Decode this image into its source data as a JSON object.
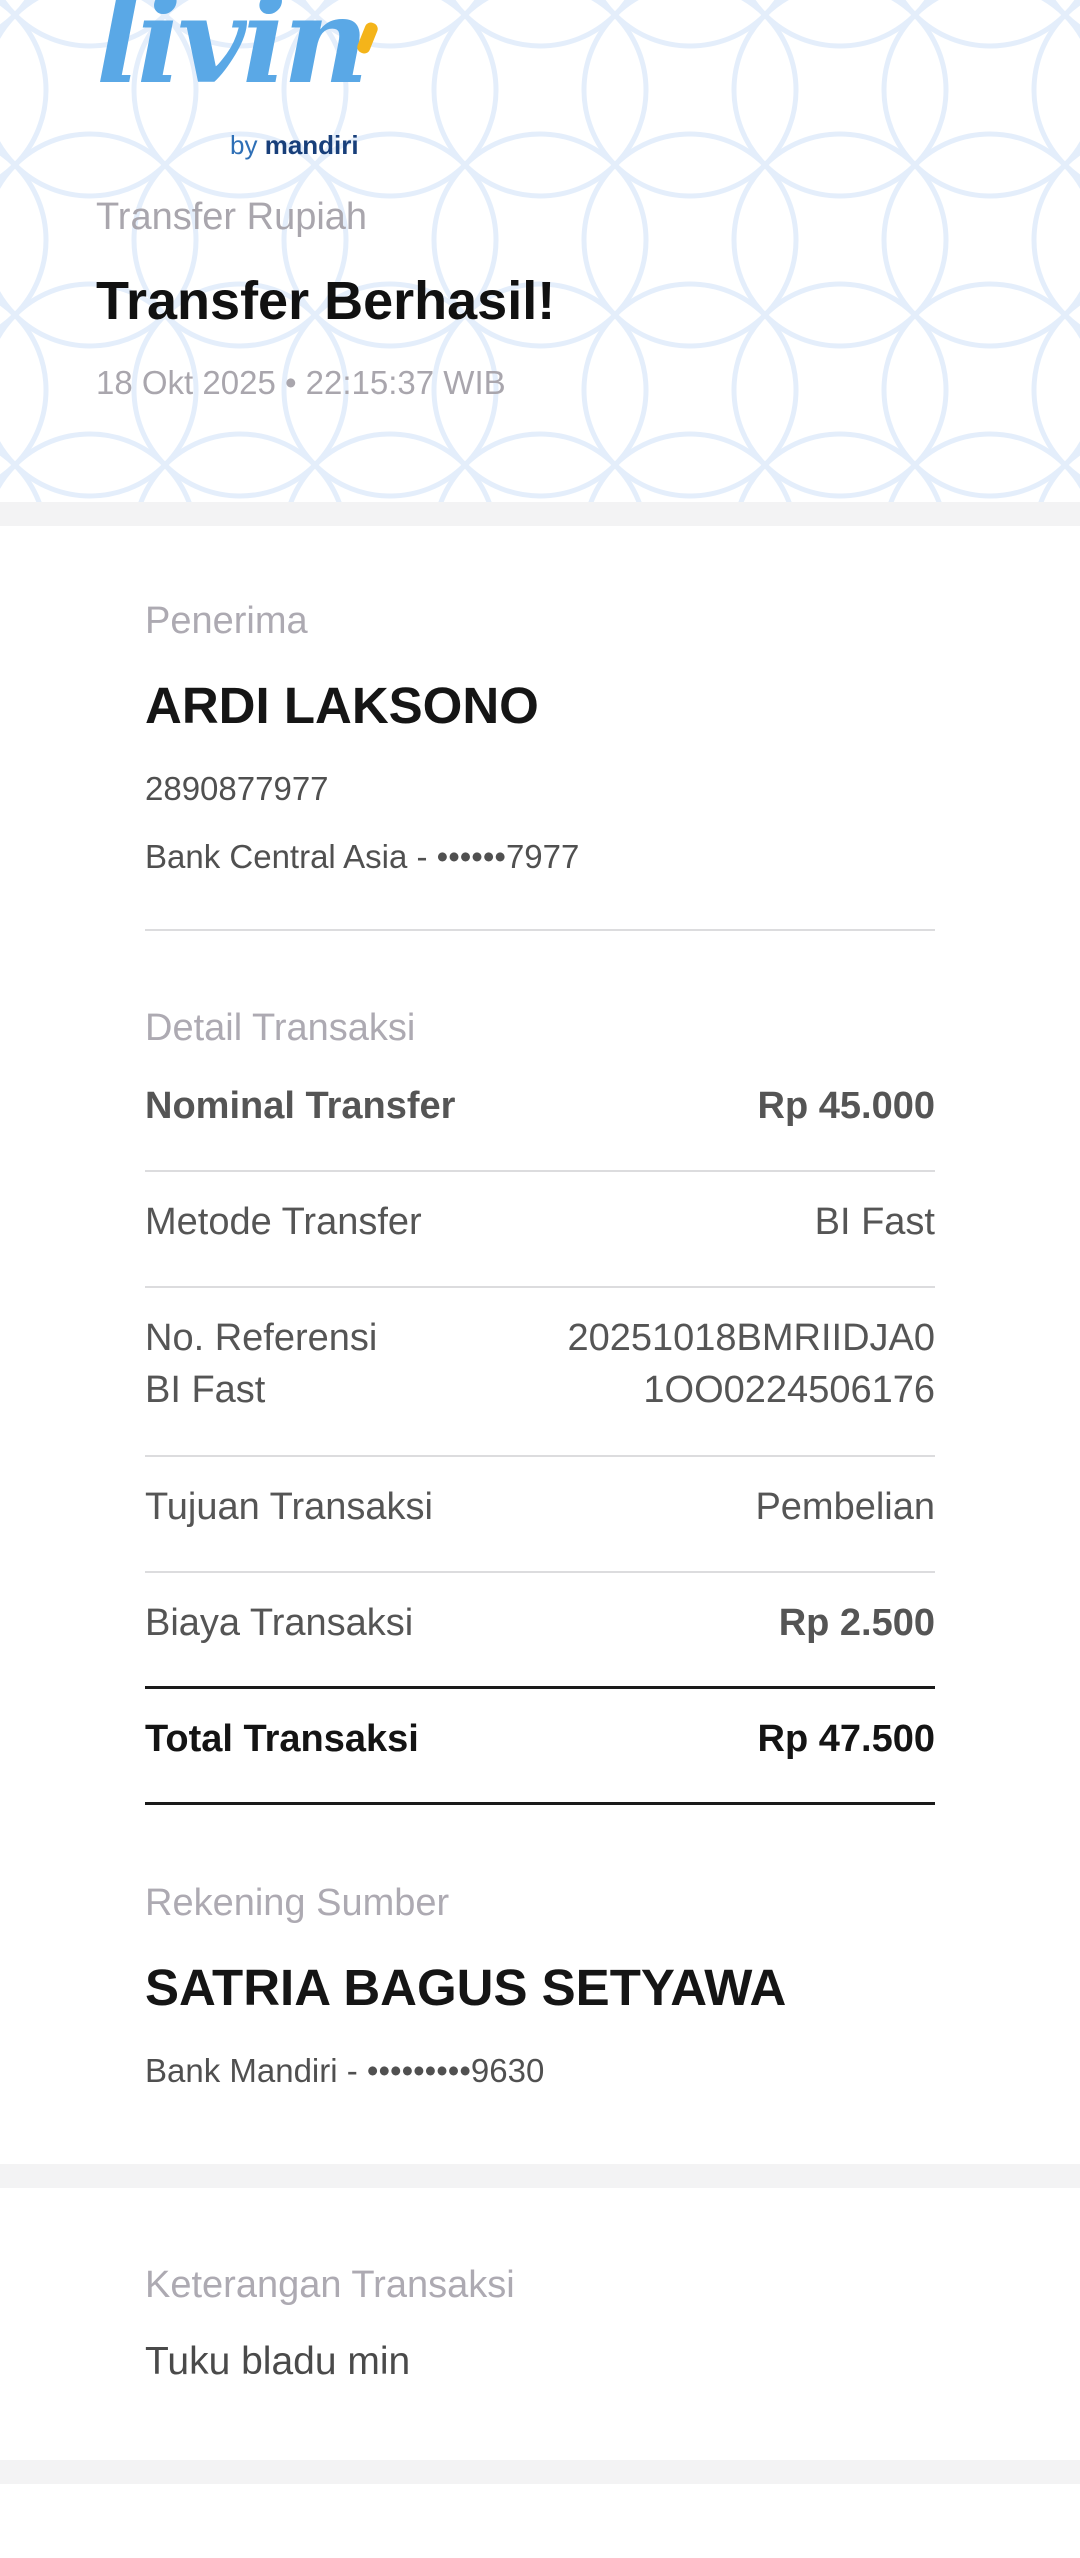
{
  "brand": {
    "logo_script": "livin",
    "logo_by": "by",
    "logo_bank": "mandiri"
  },
  "header": {
    "subtitle": "Transfer Rupiah",
    "title": "Transfer Berhasil!",
    "datetime": "18 Okt 2025 • 22:15:37 WIB"
  },
  "recipient": {
    "label": "Penerima",
    "name": "ARDI LAKSONO",
    "account_number": "2890877977",
    "bank": "Bank Central Asia - ••••••7977"
  },
  "details": {
    "label": "Detail Transaksi",
    "rows": [
      {
        "label": "Nominal Transfer",
        "value": "Rp 45.000"
      },
      {
        "label": "Metode Transfer",
        "value": "BI Fast"
      },
      {
        "label": "No. Referensi\nBI Fast",
        "value": "20251018BMRIIDJA0\n1OO0224506176"
      },
      {
        "label": "Tujuan Transaksi",
        "value": "Pembelian"
      },
      {
        "label": "Biaya Transaksi",
        "value": "Rp 2.500"
      },
      {
        "label": "Total Transaksi",
        "value": "Rp 47.500"
      }
    ]
  },
  "source": {
    "label": "Rekening Sumber",
    "name": "SATRIA BAGUS SETYAWA",
    "bank": "Bank Mandiri - •••••••••9630"
  },
  "note": {
    "label": "Keterangan Transaksi",
    "text": "Tuku bladu min"
  },
  "colors": {
    "logo_blue": "#5aa8e6",
    "logo_accent": "#f4b41a",
    "pattern": "#e4eefb",
    "separator": "#f3f3f4"
  }
}
